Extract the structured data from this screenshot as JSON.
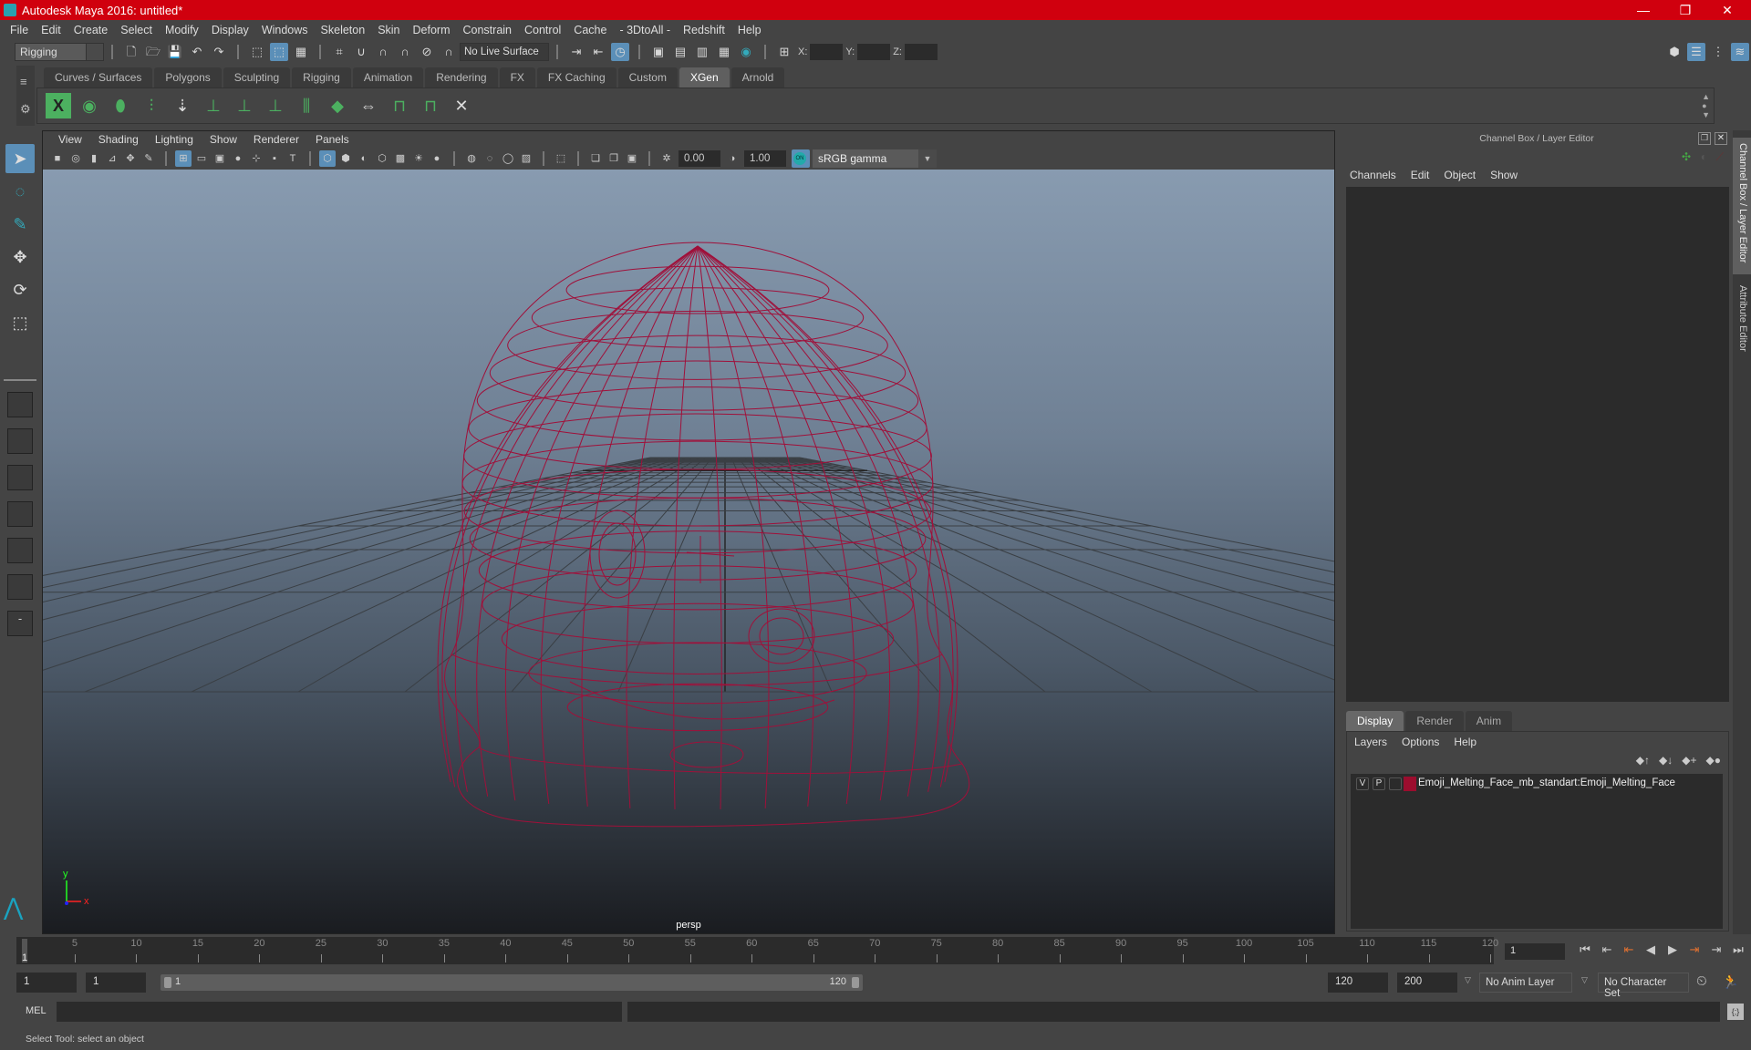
{
  "window": {
    "title": "Autodesk Maya 2016: untitled*",
    "controls": [
      "minimize",
      "restore",
      "close"
    ]
  },
  "menubar": [
    "File",
    "Edit",
    "Create",
    "Select",
    "Modify",
    "Display",
    "Windows",
    "Skeleton",
    "Skin",
    "Deform",
    "Constrain",
    "Control",
    "Cache",
    "- 3DtoAll -",
    "Redshift",
    "Help"
  ],
  "statusline": {
    "mode": "Rigging",
    "live_surface": "No Live Surface",
    "xyz_labels": [
      "X:",
      "Y:",
      "Z:"
    ],
    "icons": [
      "new-scene-icon",
      "open-scene-icon",
      "save-scene-icon",
      "undo-icon",
      "redo-icon",
      "select-hierarchy-icon",
      "select-object-icon",
      "select-component-icon",
      "snap-grid-icon",
      "snap-curve-icon",
      "snap-point-icon",
      "snap-view-plane-icon",
      "snap-surface-icon",
      "make-live-icon",
      "input-ops-icon",
      "output-ops-icon",
      "construction-history-icon",
      "render-current-icon",
      "render-sequence-icon",
      "ipr-render-icon",
      "render-settings-icon",
      "hypershade-icon",
      "transform-constraint-icon"
    ]
  },
  "shelf": {
    "tabs": [
      "Curves / Surfaces",
      "Polygons",
      "Sculpting",
      "Rigging",
      "Animation",
      "Rendering",
      "FX",
      "FX Caching",
      "Custom",
      "XGen",
      "Arnold"
    ],
    "active_tab": "XGen",
    "icons": [
      "xgen-window-icon",
      "preview-icon",
      "clear-preview-icon",
      "create-description-icon",
      "place-guide-icon",
      "add-guide-icon",
      "sculpt-guide-icon",
      "lock-guide-icon",
      "guide-length-icon",
      "guide-density-icon",
      "flip-guide-icon",
      "select-guide-icon",
      "guide-box-icon",
      "delete-guide-icon"
    ]
  },
  "toolbox": {
    "tools": [
      "select-tool-icon",
      "lasso-tool-icon",
      "paint-select-icon",
      "move-tool-icon",
      "rotate-tool-icon",
      "scale-tool-icon"
    ],
    "layouts": [
      "single-perspective-icon",
      "four-view-icon",
      "persp-outliner-icon",
      "persp-graph-icon",
      "hypershade-layout-icon",
      "persp-graph-outliner-icon"
    ],
    "more": "-"
  },
  "viewport": {
    "menus": [
      "View",
      "Shading",
      "Lighting",
      "Show",
      "Renderer",
      "Panels"
    ],
    "exposure": "0.00",
    "gamma": "1.00",
    "color_management": "sRGB gamma",
    "camera_label": "persp",
    "axis": {
      "x": "x",
      "y": "y"
    },
    "wireframe_color": "#a0103a",
    "grid_color": "#3a3f44"
  },
  "channel_box": {
    "title": "Channel Box / Layer Editor",
    "menus": [
      "Channels",
      "Edit",
      "Object",
      "Show"
    ]
  },
  "layer_editor": {
    "tabs": [
      "Display",
      "Render",
      "Anim"
    ],
    "active_tab": "Display",
    "menus": [
      "Layers",
      "Options",
      "Help"
    ],
    "layers": [
      {
        "visible": "V",
        "playback": "P",
        "color": "#9b0d2e",
        "name": "Emoji_Melting_Face_mb_standart:Emoji_Melting_Face"
      }
    ]
  },
  "side_tabs": [
    "Channel Box / Layer Editor",
    "Attribute Editor"
  ],
  "timeline": {
    "ticks": [
      5,
      10,
      15,
      20,
      25,
      30,
      35,
      40,
      45,
      50,
      55,
      60,
      65,
      70,
      75,
      80,
      85,
      90,
      95,
      100,
      105,
      110,
      115,
      120
    ],
    "start": 1,
    "end": 120,
    "current_frame_label": "1",
    "current_frame": "1"
  },
  "range": {
    "start": "1",
    "playback_start": "1",
    "slider_start": "1",
    "slider_end": "120",
    "playback_end": "120",
    "end": "200",
    "anim_layer": "No Anim Layer",
    "character_set": "No Character Set"
  },
  "command_line": {
    "language": "MEL"
  },
  "status_message": "Select Tool: select an object"
}
